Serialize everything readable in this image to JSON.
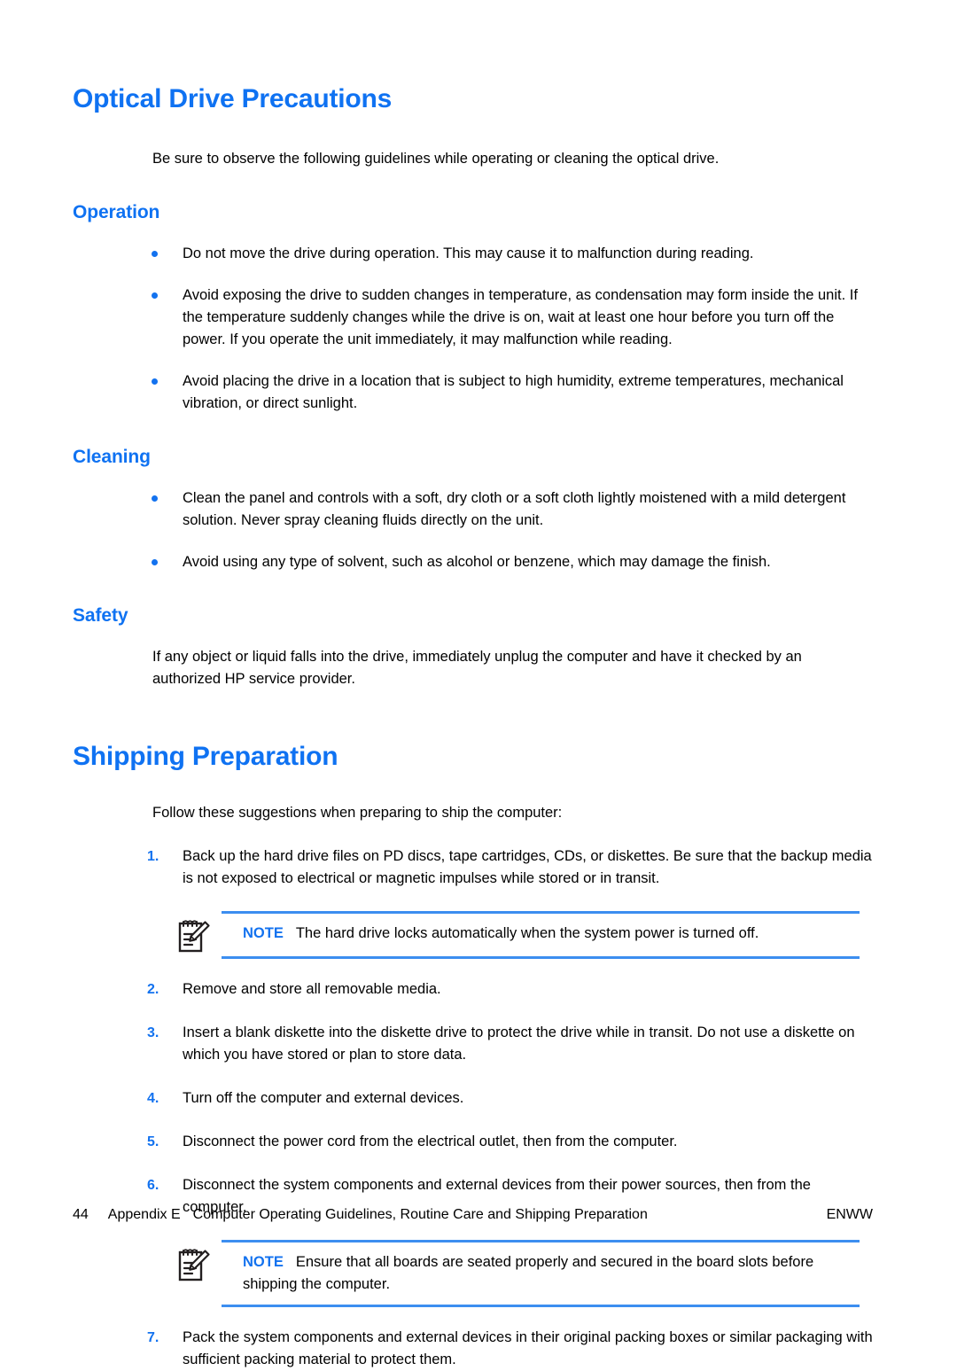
{
  "page": {
    "sections": [
      {
        "id": "optical-drive-precautions",
        "heading": "Optical Drive Precautions",
        "intro": "Be sure to observe the following guidelines while operating or cleaning the optical drive."
      }
    ],
    "operation": {
      "heading": "Operation",
      "bullets": [
        "Do not move the drive during operation. This may cause it to malfunction during reading.",
        "Avoid exposing the drive to sudden changes in temperature, as condensation may form inside the unit. If the temperature suddenly changes while the drive is on, wait at least one hour before you turn off the power. If you operate the unit immediately, it may malfunction while reading.",
        "Avoid placing the drive in a location that is subject to high humidity, extreme temperatures, mechanical vibration, or direct sunlight."
      ]
    },
    "cleaning": {
      "heading": "Cleaning",
      "bullets": [
        "Clean the panel and controls with a soft, dry cloth or a soft cloth lightly moistened with a mild detergent solution. Never spray cleaning fluids directly on the unit.",
        "Avoid using any type of solvent, such as alcohol or benzene, which may damage the finish."
      ]
    },
    "safety": {
      "heading": "Safety",
      "body": "If any object or liquid falls into the drive, immediately unplug the computer and have it checked by an authorized HP service provider."
    },
    "shipping": {
      "heading": "Shipping Preparation",
      "intro": "Follow these suggestions when preparing to ship the computer:",
      "steps": [
        {
          "num": "1.",
          "text": "Back up the hard drive files on PD discs, tape cartridges, CDs, or diskettes. Be sure that the backup media is not exposed to electrical or magnetic impulses while stored or in transit."
        },
        {
          "num": "2.",
          "text": "Remove and store all removable media."
        },
        {
          "num": "3.",
          "text": "Insert a blank diskette into the diskette drive to protect the drive while in transit. Do not use a diskette on which you have stored or plan to store data."
        },
        {
          "num": "4.",
          "text": "Turn off the computer and external devices."
        },
        {
          "num": "5.",
          "text": "Disconnect the power cord from the electrical outlet, then from the computer."
        },
        {
          "num": "6.",
          "text": "Disconnect the system components and external devices from their power sources, then from the computer."
        },
        {
          "num": "7.",
          "text": "Pack the system components and external devices in their original packing boxes or similar packaging with sufficient packing material to protect them."
        }
      ],
      "notes": [
        {
          "label": "NOTE",
          "text": "The hard drive locks automatically when the system power is turned off.",
          "icon": "note-pad-pencil-icon"
        },
        {
          "label": "NOTE",
          "text": "Ensure that all boards are seated properly and secured in the board slots before shipping the computer.",
          "icon": "note-pad-pencil-icon"
        }
      ]
    },
    "footer": {
      "page_number": "44",
      "appendix": "Appendix E",
      "title": "Computer Operating Guidelines, Routine Care and Shipping Preparation",
      "language_code": "ENWW"
    },
    "colors": {
      "heading_blue": "#0f72f2",
      "accent_blue": "#1372ef",
      "rule_blue": "#3c8ef0",
      "body_text": "#000000"
    }
  }
}
